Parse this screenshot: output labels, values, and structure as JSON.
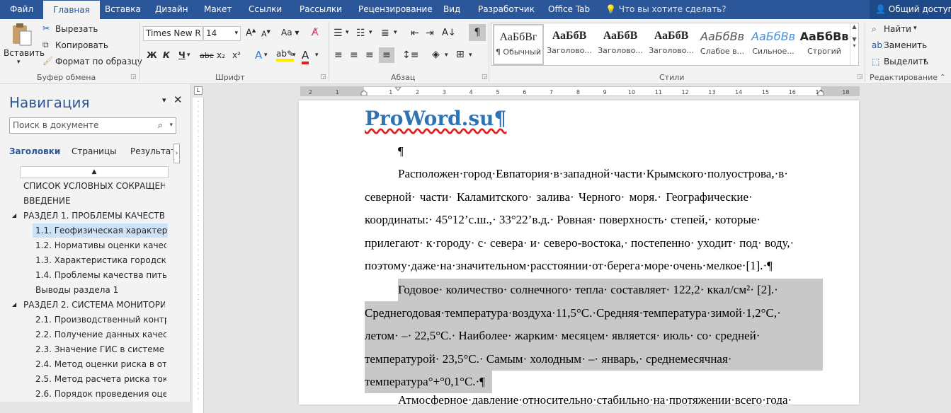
{
  "tabs": [
    "Файл",
    "Главная",
    "Вставка",
    "Дизайн",
    "Макет",
    "Ссылки",
    "Рассылки",
    "Рецензирование",
    "Вид",
    "Разработчик",
    "Office Tab"
  ],
  "tell_me": "Что вы хотите сделать?",
  "share": "Общий доступ",
  "clipboard": {
    "paste": "Вставить",
    "cut": "Вырезать",
    "copy": "Копировать",
    "format_painter": "Формат по образцу",
    "label": "Буфер обмена"
  },
  "font": {
    "name": "Times New R",
    "size": "14",
    "label": "Шрифт",
    "aa": "Aa",
    "bold": "Ж",
    "italic": "К",
    "underline": "Ч",
    "strike": "abc",
    "sub": "x₂",
    "sup": "x²"
  },
  "paragraph": {
    "label": "Абзац",
    "pilcrow": "¶"
  },
  "styles": {
    "label": "Стили",
    "items": [
      {
        "preview": "АаБбВг",
        "name": "¶ Обычный"
      },
      {
        "preview": "АаБбВ",
        "name": "Заголово..."
      },
      {
        "preview": "АаБбВ",
        "name": "Заголово..."
      },
      {
        "preview": "АаБбВ",
        "name": "Заголово..."
      },
      {
        "preview": "АаБбВв",
        "name": "Слабое в..."
      },
      {
        "preview": "АаБбВв",
        "name": "Сильное..."
      },
      {
        "preview": "АаБбВв",
        "name": "Строгий"
      }
    ]
  },
  "editing": {
    "find": "Найти",
    "replace": "Заменить",
    "select": "Выделить",
    "label": "Редактирование"
  },
  "navigation": {
    "title": "Навигация",
    "search_placeholder": "Поиск в документе",
    "tabs": [
      "Заголовки",
      "Страницы",
      "Результать"
    ],
    "items": [
      {
        "text": "СПИСОК УСЛОВНЫХ СОКРАЩЕН..."
      },
      {
        "text": "ВВЕДЕНИЕ"
      },
      {
        "text": "РАЗДЕЛ 1.  ПРОБЛЕМЫ КАЧЕСТВА..."
      },
      {
        "text": "1.1. Геофизическая характерист..."
      },
      {
        "text": "1.2. Нормативы оценки качеств..."
      },
      {
        "text": "1.3. Характеристика городской..."
      },
      {
        "text": "1.4. Проблемы качества питьев..."
      },
      {
        "text": "Выводы раздела 1"
      },
      {
        "text": "РАЗДЕЛ 2. СИСТЕМА МОНИТОРИ..."
      },
      {
        "text": "2.1. Производственный контро..."
      },
      {
        "text": "2.2. Получение данных качеств..."
      },
      {
        "text": "2.3. Значение ГИС в системе мо..."
      },
      {
        "text": "2.4. Метод оценки риска в отно..."
      },
      {
        "text": "2.5. Метод расчета риска токси..."
      },
      {
        "text": "2.6. Порядок проведения оценк..."
      }
    ]
  },
  "ruler_numbers": [
    "2",
    "1",
    "1",
    "2",
    "3",
    "4",
    "5",
    "6",
    "7",
    "8",
    "9",
    "10",
    "11",
    "12",
    "13",
    "14",
    "15",
    "16",
    "17",
    "18"
  ],
  "document": {
    "title": "ProWord.su¶",
    "lines": [
      "¶",
      "Расположен·город·Евпатория·в·западной·части·Крымского·полуострова,·в·",
      "северной·  части·  Каламитского·  залива·  Черного·  моря.·  Географические·",
      "координаты:·  45°12’с.ш.,·  33°22’в.д.·  Ровная·  поверхность·  степей,·  которые·",
      "прилегают·  к·городу·  с·  севера·  и·  северо-востока,·  постепенно·  уходит·  под·  воду,·",
      "поэтому·даже·на·значительном·расстоянии·от·берега·море·очень·мелкое·[1].·¶",
      "Годовое·  количество·  солнечного·  тепла·  составляет·  122,2·  ккал/см²·  [2].·",
      "Среднегодовая·температура·воздуха·11,5°С.·Средняя·температура·зимой·1,2°С,·",
      "летом·  –·  22,5°С.·  Наиболее·  жарким·  месяцем·  является·  июль·  со·  средней·",
      "температурой·  23,5°С.·  Самым·  холодным·  –·  январь,·  среднемесячная·",
      "температура°+°0,1°С.·¶",
      "Атмосферное·давление·относительно·стабильно·на·протяжении·всего·года·"
    ]
  }
}
